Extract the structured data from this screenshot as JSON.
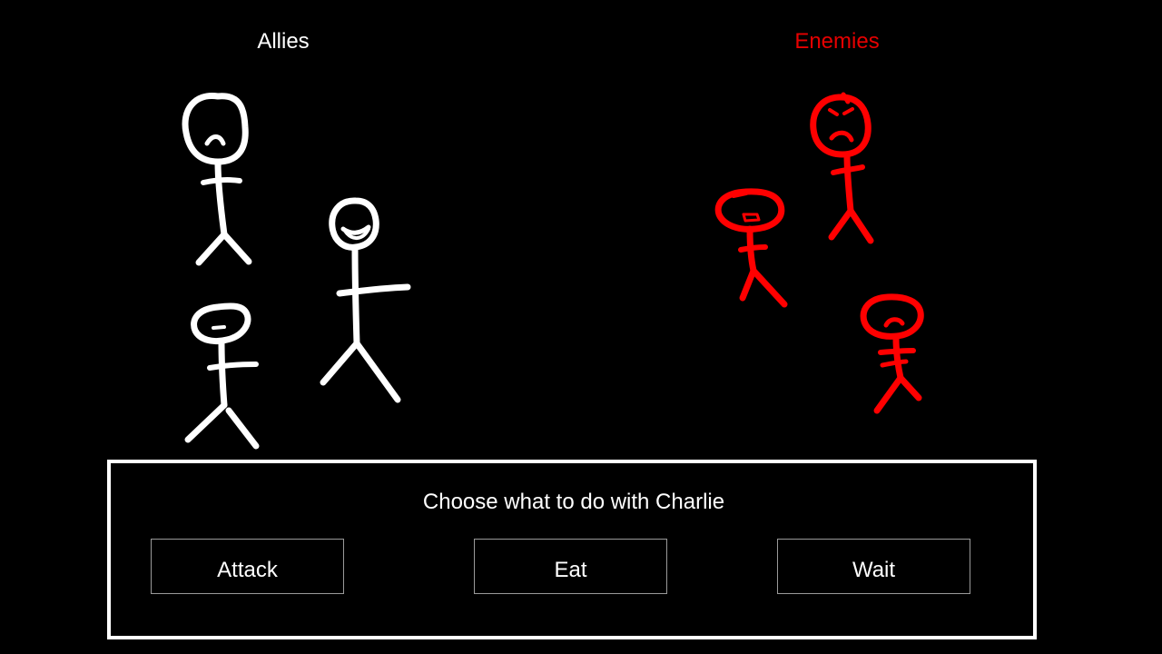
{
  "teams": {
    "allies": {
      "label": "Allies",
      "color": "#ffffff"
    },
    "enemies": {
      "label": "Enemies",
      "color": "#e60000"
    }
  },
  "fighters": {
    "ally_color": "#ffffff",
    "enemy_color": "#ff0000"
  },
  "action_panel": {
    "prompt": "Choose what to do with Charlie",
    "actions": [
      {
        "label": "Attack"
      },
      {
        "label": "Eat"
      },
      {
        "label": "Wait"
      }
    ]
  }
}
